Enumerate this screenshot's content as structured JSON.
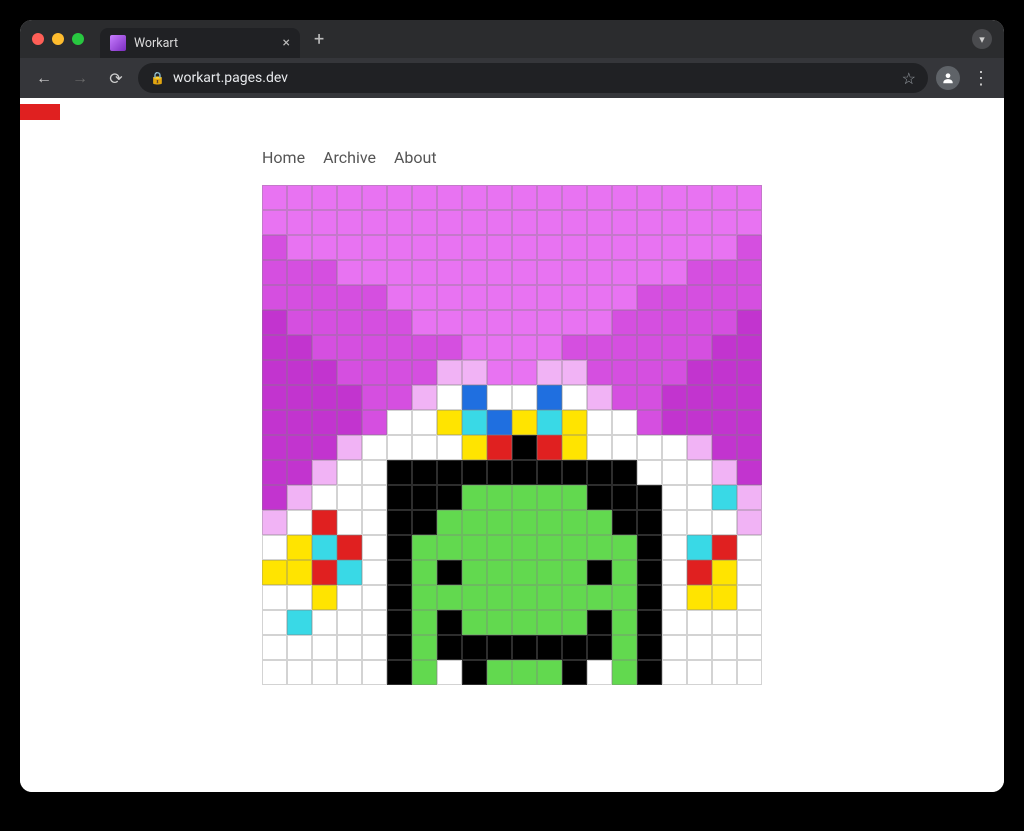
{
  "browser": {
    "tab_title": "Workart",
    "url_display": "workart.pages.dev",
    "new_tab_label": "+",
    "close_tab_label": "×",
    "back_icon": "←",
    "forward_icon": "→",
    "reload_icon": "⟳",
    "lock_icon": "🔒",
    "star_icon": "☆",
    "avatar_glyph": "⬤",
    "menu_icon": "⋮"
  },
  "nav": {
    "home": "Home",
    "archive": "Archive",
    "about": "About"
  },
  "palette": {
    "0": "#ffffff",
    "1": "#e873f2",
    "2": "#d54fe0",
    "3": "#c234cf",
    "4": "#f1b3f5",
    "5": "#000000",
    "6": "#62d94f",
    "7": "#1f6fe0",
    "8": "#ffe400",
    "9": "#e02020",
    "a": "#39d9e6"
  },
  "pixel_rows": [
    "11111111111111111111",
    "11111111111111111111",
    "21111111111111111112",
    "22211111111111111222",
    "22222111111111122222",
    "32222211111111222223",
    "33222222111122222233",
    "33322224411442222333",
    "33332240700704223333",
    "33332008a78a80023333",
    "33340000895980000433",
    "33400555555555500043",
    "340005556666655500a4",
    "40900556666666550004",
    "08a90566666666650a90",
    "889a0565666665650980",
    "00800566666666650880",
    "0a000565666665650000",
    "00000565555555650000",
    "00000560566650650000"
  ]
}
